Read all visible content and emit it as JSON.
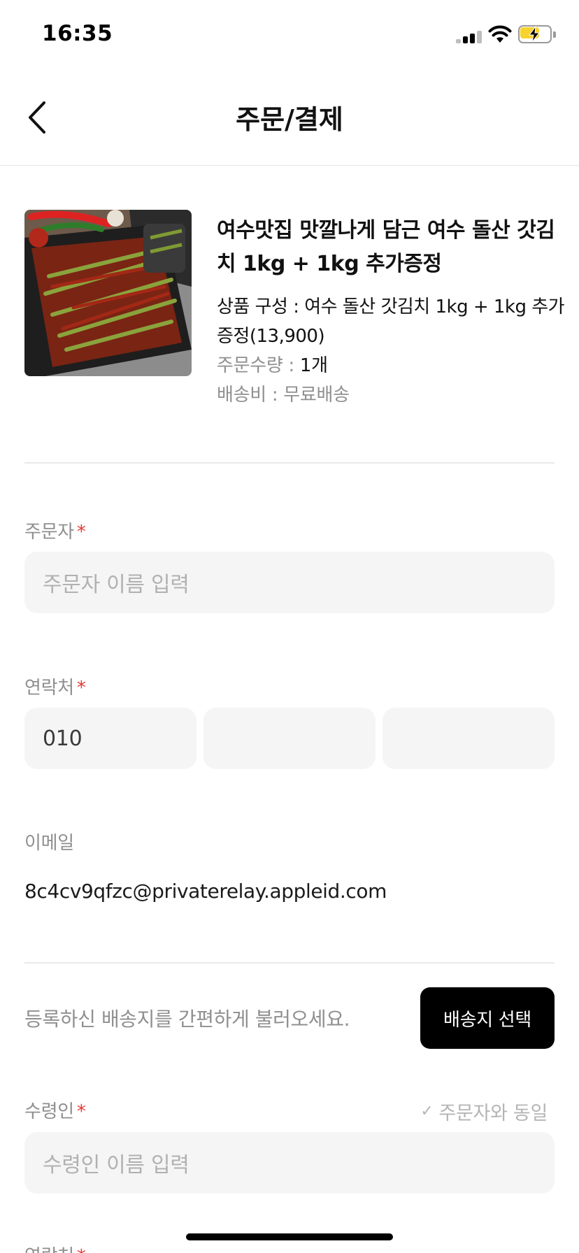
{
  "status_bar": {
    "time": "16:35"
  },
  "header": {
    "title": "주문/결제"
  },
  "product": {
    "title": "여수맛집 맛깔나게 담근 여수 돌산 갓김치 1kg + 1kg 추가증정",
    "option_label": "상품 구성 : ",
    "option_value": "여수 돌산 갓김치 1kg + 1kg 추가증정(13,900)",
    "quantity_label": "주문수량 : ",
    "quantity_value": "1개",
    "shipping_label": "배송비 : ",
    "shipping_value": "무료배송"
  },
  "form": {
    "orderer": {
      "label": "주문자",
      "required_mark": "*",
      "placeholder": "주문자 이름 입력"
    },
    "contact": {
      "label": "연락처",
      "required_mark": "*",
      "part1": "010",
      "part2": "",
      "part3": ""
    },
    "email": {
      "label": "이메일",
      "value": "8c4cv9qfzc@privaterelay.appleid.com"
    },
    "address": {
      "hint": "등록하신 배송지를 간편하게 불러오세요.",
      "select_button": "배송지 선택"
    },
    "recipient": {
      "label": "수령인",
      "required_mark": "*",
      "placeholder": "수령인 이름 입력",
      "same_as_orderer": "주문자와 동일",
      "check_mark": "✓"
    },
    "recipient_contact": {
      "label": "연락처",
      "required_mark": "*"
    }
  },
  "colors": {
    "accent": "#000000",
    "required": "#e53935",
    "input_bg": "#f5f5f5",
    "muted_text": "#8f8f8f"
  }
}
